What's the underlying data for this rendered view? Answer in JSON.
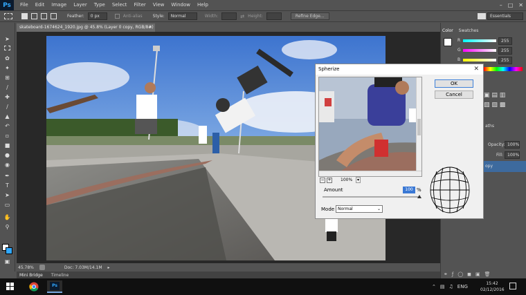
{
  "app": {
    "logo": "Ps"
  },
  "menu": {
    "items": [
      "File",
      "Edit",
      "Image",
      "Layer",
      "Type",
      "Select",
      "Filter",
      "View",
      "Window",
      "Help"
    ]
  },
  "options_bar": {
    "feather_label": "Feather:",
    "feather_value": "0 px",
    "anti_alias_label": "Anti-alias",
    "style_label": "Style:",
    "style_value": "Normal",
    "width_label": "Width:",
    "height_label": "Height:",
    "refine_edge_label": "Refine Edge...",
    "workspace_value": "Essentials"
  },
  "document": {
    "tab_title": "skateboard-1674624_1920.jpg @ 45.8% (Layer 0 copy, RGB/8#) *"
  },
  "status": {
    "zoom": "45.78%",
    "doc_size": "Doc: 7.03M/14.1M"
  },
  "bottom_tabs": [
    "Mini Bridge",
    "Timeline"
  ],
  "right_panel": {
    "tabs": [
      "Color",
      "Swatches"
    ],
    "color_values": {
      "r": "255",
      "g": "255",
      "b": "255"
    },
    "channel_labels": {
      "r": "R",
      "g": "G",
      "b": "B"
    },
    "opacity_label": "Opacity:",
    "opacity_value": "100%",
    "fill_label": "Fill:",
    "fill_value": "100%",
    "layer_name_fragment": "opy",
    "paths_fragment": "aths"
  },
  "dialog": {
    "title": "Spherize",
    "ok_label": "OK",
    "cancel_label": "Cancel",
    "zoom_value": "100%",
    "amount_label": "Amount",
    "amount_value": "100",
    "amount_unit": "%",
    "mode_label": "Mode",
    "mode_value": "Normal"
  },
  "taskbar": {
    "time": "15:42",
    "date": "02/12/2016",
    "lang": "ENG"
  },
  "colors": {
    "ui_bg": "#535353",
    "canvas_bg": "#282828",
    "accent": "#31a8ff"
  }
}
